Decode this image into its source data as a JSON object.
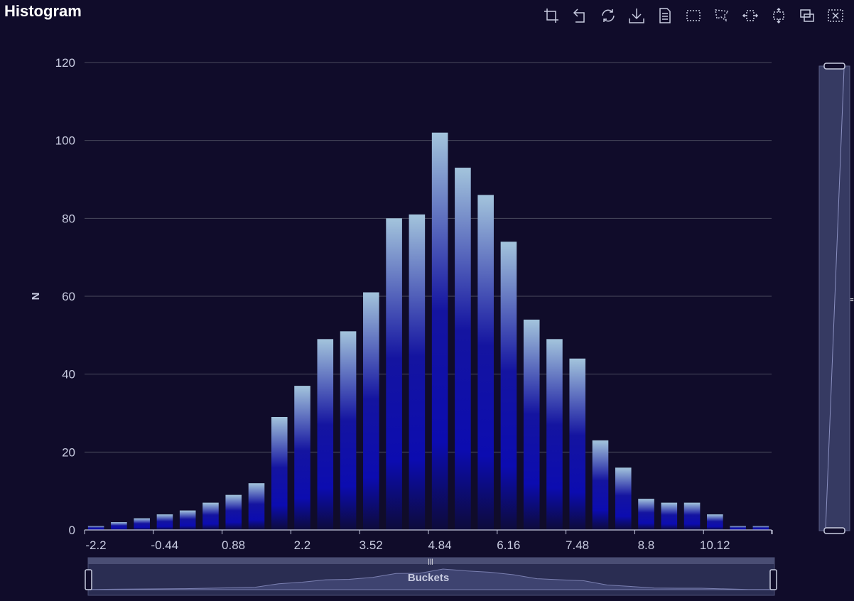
{
  "title": "Histogram",
  "toolbox": [
    {
      "name": "crop-icon",
      "label": "Zoom"
    },
    {
      "name": "undo-icon",
      "label": "Zoom reset"
    },
    {
      "name": "refresh-icon",
      "label": "Restore"
    },
    {
      "name": "download-icon",
      "label": "Save as image"
    },
    {
      "name": "document-icon",
      "label": "Data view"
    },
    {
      "name": "rect-select-icon",
      "label": "Rectangle select"
    },
    {
      "name": "polygon-select-icon",
      "label": "Polygon select"
    },
    {
      "name": "lineX-select-icon",
      "label": "Horizontal select"
    },
    {
      "name": "lineY-select-icon",
      "label": "Vertical select"
    },
    {
      "name": "keep-select-icon",
      "label": "Keep selections"
    },
    {
      "name": "clear-select-icon",
      "label": "Clear selections"
    }
  ],
  "chart_data": {
    "type": "bar",
    "title": "Histogram",
    "xlabel": "",
    "ylabel": "N",
    "ylim": [
      0,
      120
    ],
    "yticks": [
      0,
      20,
      40,
      60,
      80,
      100,
      120
    ],
    "xtick_labels": [
      "-2.2",
      "-0.44",
      "0.88",
      "2.2",
      "3.52",
      "4.84",
      "6.16",
      "7.48",
      "8.8",
      "10.12"
    ],
    "values": [
      1,
      2,
      3,
      4,
      5,
      7,
      9,
      12,
      29,
      37,
      49,
      51,
      61,
      80,
      81,
      102,
      93,
      86,
      74,
      54,
      49,
      44,
      23,
      16,
      8,
      7,
      7,
      4,
      1,
      1
    ],
    "grid": true,
    "datazoom_x_label": "Buckets",
    "colors": {
      "bar_top": "#a3c4dc",
      "bar_mid": "#0c0ca8",
      "bar_bottom": "#0d0b3a",
      "grid": "#4a4a5e",
      "axis": "#c8cbe0"
    }
  }
}
